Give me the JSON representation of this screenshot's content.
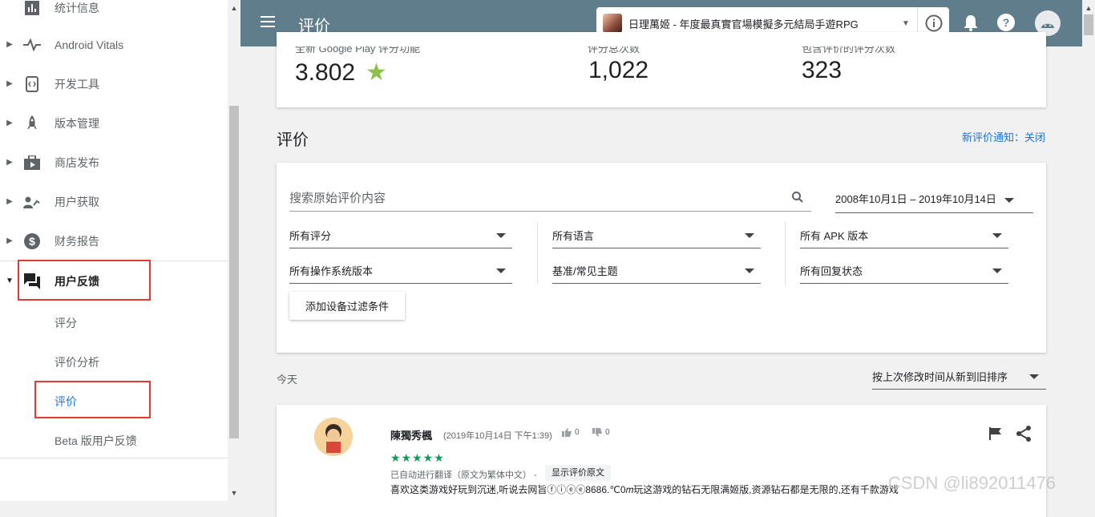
{
  "sidebar": {
    "items": [
      {
        "label": "统计信息"
      },
      {
        "label": "Android Vitals"
      },
      {
        "label": "开发工具"
      },
      {
        "label": "版本管理"
      },
      {
        "label": "商店发布"
      },
      {
        "label": "用户获取"
      },
      {
        "label": "财务报告"
      },
      {
        "label": "用户反馈"
      }
    ],
    "subitems": [
      {
        "label": "评分"
      },
      {
        "label": "评价分析"
      },
      {
        "label": "评价"
      },
      {
        "label": "Beta 版用户反馈"
      }
    ]
  },
  "topbar": {
    "title": "评价",
    "app_name": "日理萬姬 - 年度最真實官場模擬多元結局手遊RPG"
  },
  "stats": [
    {
      "label": "全新 Google Play 评分功能",
      "value": "3.802"
    },
    {
      "label": "评分总次数",
      "value": "1,022"
    },
    {
      "label": "包含评价的评分次数",
      "value": "323"
    }
  ],
  "reviews_section": {
    "title": "评价",
    "notify": "新评价通知：关闭"
  },
  "filters": {
    "search_placeholder": "搜索原始评价内容",
    "date_range": "2008年10月1日 – 2019年10月14日",
    "ratings": "所有评分",
    "languages": "所有语言",
    "apk": "所有 APK 版本",
    "os": "所有操作系统版本",
    "topics": "基准/常见主题",
    "reply": "所有回复状态",
    "add_device": "添加设备过滤条件"
  },
  "list": {
    "group": "今天",
    "sort": "按上次修改时间从新到旧排序"
  },
  "review": {
    "author": "陳獨秀楓",
    "time": "(2019年10月14日 下午1:39)",
    "likes": "0",
    "dislikes": "0",
    "stars": "★★★★★",
    "translated": "已自动进行翻译（原文为繁体中文） -",
    "show_original": "显示评价原文",
    "text": "喜欢这类游戏好玩到沉迷,听说去网旨ⓕⓘⓔⓔ8686.℃0𝑚玩这游戏的钻石无限满姬版,资源钻石都是无限的,还有千款游戏"
  },
  "watermark": "CSDN @li892011476",
  "colors": {
    "topbar": "#607d8b",
    "accent": "#1a73e8",
    "star": "#8bc34a",
    "highlight": "#e53935"
  }
}
